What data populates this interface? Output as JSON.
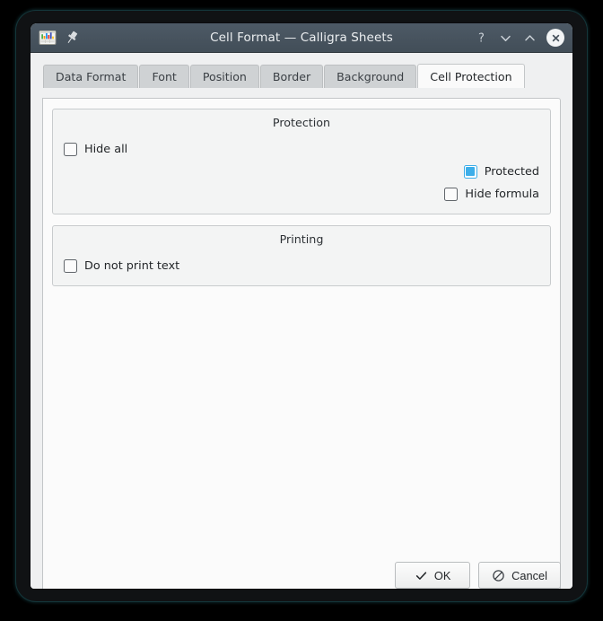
{
  "window": {
    "title": "Cell Format — Calligra Sheets",
    "app_icon": "calligra-sheets-icon",
    "pin_icon": "pin-icon",
    "controls": {
      "help": "?",
      "minimize": "minimize-icon",
      "maximize": "maximize-icon",
      "close": "close-icon"
    },
    "titlebar_color": "#47535e",
    "accent_color": "#3daee9"
  },
  "tabs": [
    {
      "label": "Data Format",
      "active": false
    },
    {
      "label": "Font",
      "active": false
    },
    {
      "label": "Position",
      "active": false
    },
    {
      "label": "Border",
      "active": false
    },
    {
      "label": "Background",
      "active": false
    },
    {
      "label": "Cell Protection",
      "active": true
    }
  ],
  "groups": [
    {
      "title": "Protection",
      "checkboxes": [
        {
          "label": "Hide all",
          "checked": false,
          "align": "left"
        },
        {
          "label": "Protected",
          "checked": true,
          "align": "right"
        },
        {
          "label": "Hide formula",
          "checked": false,
          "align": "right"
        }
      ]
    },
    {
      "title": "Printing",
      "checkboxes": [
        {
          "label": "Do not print text",
          "checked": false,
          "align": "left"
        }
      ]
    }
  ],
  "buttons": {
    "ok": "OK",
    "cancel": "Cancel"
  }
}
